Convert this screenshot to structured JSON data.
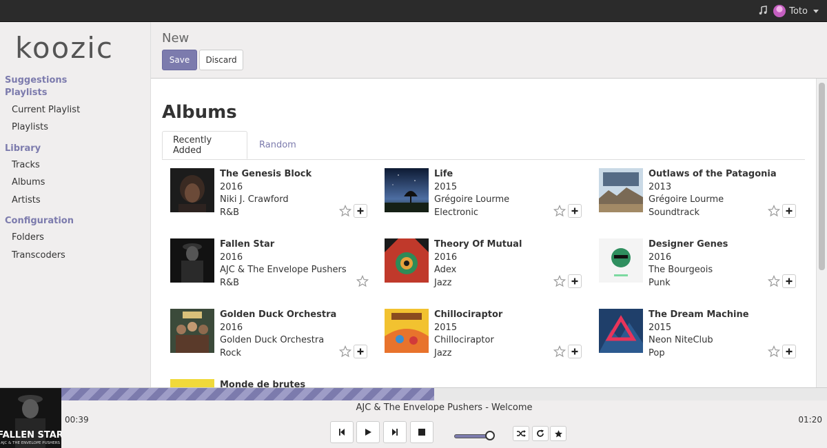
{
  "topbar": {
    "user_name": "Toto",
    "music_icon": "music-note-icon"
  },
  "sidebar": {
    "logo": "koozic",
    "sections": [
      {
        "label": "Suggestions"
      },
      {
        "label": "Playlists",
        "items": [
          "Current Playlist",
          "Playlists"
        ]
      },
      {
        "label": "Library",
        "items": [
          "Tracks",
          "Albums",
          "Artists"
        ]
      },
      {
        "label": "Configuration",
        "items": [
          "Folders",
          "Transcoders"
        ]
      }
    ]
  },
  "control": {
    "title": "New",
    "save_label": "Save",
    "discard_label": "Discard"
  },
  "main": {
    "heading": "Albums",
    "tabs": [
      {
        "label": "Recently Added",
        "active": true
      },
      {
        "label": "Random",
        "active": false
      }
    ],
    "albums": [
      {
        "title": "The Genesis Block",
        "year": "2016",
        "artist": "Niki J. Crawford",
        "genre": "R&B"
      },
      {
        "title": "Life",
        "year": "2015",
        "artist": "Grégoire Lourme",
        "genre": "Electronic"
      },
      {
        "title": "Outlaws of the Patagonia",
        "year": "2013",
        "artist": "Grégoire Lourme",
        "genre": "Soundtrack"
      },
      {
        "title": "Fallen Star",
        "year": "2016",
        "artist": "AJC & The Envelope Pushers",
        "genre": "R&B"
      },
      {
        "title": "Theory Of Mutual",
        "year": "2016",
        "artist": "Adex",
        "genre": "Jazz"
      },
      {
        "title": "Designer Genes",
        "year": "2016",
        "artist": "The Bourgeois",
        "genre": "Punk"
      },
      {
        "title": "Golden Duck Orchestra",
        "year": "2016",
        "artist": "Golden Duck Orchestra",
        "genre": "Rock"
      },
      {
        "title": "Chillociraptor",
        "year": "2015",
        "artist": "Chillociraptor",
        "genre": "Jazz"
      },
      {
        "title": "The Dream Machine",
        "year": "2015",
        "artist": "Neon NiteClub",
        "genre": "Pop"
      },
      {
        "title": "Monde de brutes",
        "year": "",
        "artist": "",
        "genre": ""
      }
    ]
  },
  "player": {
    "now_playing": "AJC & The Envelope Pushers - Welcome",
    "elapsed": "00:39",
    "duration": "01:20",
    "progress_fraction": 0.487,
    "volume_fraction": 0.85,
    "cover_text_1": "FALLEN STAR",
    "cover_text_2": "AJC & THE ENVELOPE PUSHERS"
  },
  "colors": {
    "accent": "#7c7bad",
    "topbar": "#2b2b2b",
    "panel": "#f0eeee"
  }
}
